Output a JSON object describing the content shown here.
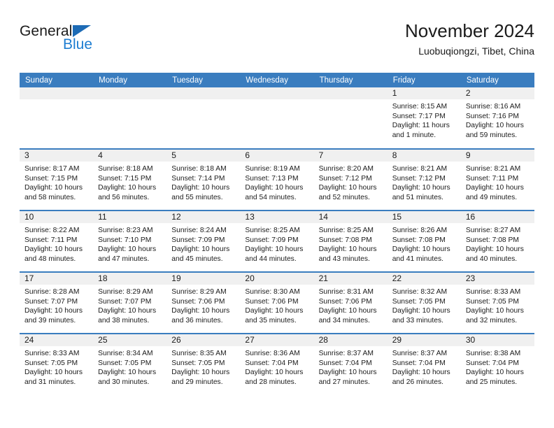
{
  "branding": {
    "logo_text_top": "General",
    "logo_text_bottom": "Blue",
    "logo_triangle_color": "#1d6bb5",
    "logo_blue_color": "#1d7dd1"
  },
  "header": {
    "title": "November 2024",
    "subtitle": "Luobuqiongzi, Tibet, China"
  },
  "colors": {
    "header_band": "#3a7dbf",
    "daynum_band": "#f0f0f0",
    "text": "#1b1b1b"
  },
  "weekdays": [
    "Sunday",
    "Monday",
    "Tuesday",
    "Wednesday",
    "Thursday",
    "Friday",
    "Saturday"
  ],
  "weeks": [
    [
      {
        "day": "",
        "sunrise": "",
        "sunset": "",
        "daylight_line1": "",
        "daylight_line2": ""
      },
      {
        "day": "",
        "sunrise": "",
        "sunset": "",
        "daylight_line1": "",
        "daylight_line2": ""
      },
      {
        "day": "",
        "sunrise": "",
        "sunset": "",
        "daylight_line1": "",
        "daylight_line2": ""
      },
      {
        "day": "",
        "sunrise": "",
        "sunset": "",
        "daylight_line1": "",
        "daylight_line2": ""
      },
      {
        "day": "",
        "sunrise": "",
        "sunset": "",
        "daylight_line1": "",
        "daylight_line2": ""
      },
      {
        "day": "1",
        "sunrise": "Sunrise: 8:15 AM",
        "sunset": "Sunset: 7:17 PM",
        "daylight_line1": "Daylight: 11 hours",
        "daylight_line2": "and 1 minute."
      },
      {
        "day": "2",
        "sunrise": "Sunrise: 8:16 AM",
        "sunset": "Sunset: 7:16 PM",
        "daylight_line1": "Daylight: 10 hours",
        "daylight_line2": "and 59 minutes."
      }
    ],
    [
      {
        "day": "3",
        "sunrise": "Sunrise: 8:17 AM",
        "sunset": "Sunset: 7:15 PM",
        "daylight_line1": "Daylight: 10 hours",
        "daylight_line2": "and 58 minutes."
      },
      {
        "day": "4",
        "sunrise": "Sunrise: 8:18 AM",
        "sunset": "Sunset: 7:15 PM",
        "daylight_line1": "Daylight: 10 hours",
        "daylight_line2": "and 56 minutes."
      },
      {
        "day": "5",
        "sunrise": "Sunrise: 8:18 AM",
        "sunset": "Sunset: 7:14 PM",
        "daylight_line1": "Daylight: 10 hours",
        "daylight_line2": "and 55 minutes."
      },
      {
        "day": "6",
        "sunrise": "Sunrise: 8:19 AM",
        "sunset": "Sunset: 7:13 PM",
        "daylight_line1": "Daylight: 10 hours",
        "daylight_line2": "and 54 minutes."
      },
      {
        "day": "7",
        "sunrise": "Sunrise: 8:20 AM",
        "sunset": "Sunset: 7:12 PM",
        "daylight_line1": "Daylight: 10 hours",
        "daylight_line2": "and 52 minutes."
      },
      {
        "day": "8",
        "sunrise": "Sunrise: 8:21 AM",
        "sunset": "Sunset: 7:12 PM",
        "daylight_line1": "Daylight: 10 hours",
        "daylight_line2": "and 51 minutes."
      },
      {
        "day": "9",
        "sunrise": "Sunrise: 8:21 AM",
        "sunset": "Sunset: 7:11 PM",
        "daylight_line1": "Daylight: 10 hours",
        "daylight_line2": "and 49 minutes."
      }
    ],
    [
      {
        "day": "10",
        "sunrise": "Sunrise: 8:22 AM",
        "sunset": "Sunset: 7:11 PM",
        "daylight_line1": "Daylight: 10 hours",
        "daylight_line2": "and 48 minutes."
      },
      {
        "day": "11",
        "sunrise": "Sunrise: 8:23 AM",
        "sunset": "Sunset: 7:10 PM",
        "daylight_line1": "Daylight: 10 hours",
        "daylight_line2": "and 47 minutes."
      },
      {
        "day": "12",
        "sunrise": "Sunrise: 8:24 AM",
        "sunset": "Sunset: 7:09 PM",
        "daylight_line1": "Daylight: 10 hours",
        "daylight_line2": "and 45 minutes."
      },
      {
        "day": "13",
        "sunrise": "Sunrise: 8:25 AM",
        "sunset": "Sunset: 7:09 PM",
        "daylight_line1": "Daylight: 10 hours",
        "daylight_line2": "and 44 minutes."
      },
      {
        "day": "14",
        "sunrise": "Sunrise: 8:25 AM",
        "sunset": "Sunset: 7:08 PM",
        "daylight_line1": "Daylight: 10 hours",
        "daylight_line2": "and 43 minutes."
      },
      {
        "day": "15",
        "sunrise": "Sunrise: 8:26 AM",
        "sunset": "Sunset: 7:08 PM",
        "daylight_line1": "Daylight: 10 hours",
        "daylight_line2": "and 41 minutes."
      },
      {
        "day": "16",
        "sunrise": "Sunrise: 8:27 AM",
        "sunset": "Sunset: 7:08 PM",
        "daylight_line1": "Daylight: 10 hours",
        "daylight_line2": "and 40 minutes."
      }
    ],
    [
      {
        "day": "17",
        "sunrise": "Sunrise: 8:28 AM",
        "sunset": "Sunset: 7:07 PM",
        "daylight_line1": "Daylight: 10 hours",
        "daylight_line2": "and 39 minutes."
      },
      {
        "day": "18",
        "sunrise": "Sunrise: 8:29 AM",
        "sunset": "Sunset: 7:07 PM",
        "daylight_line1": "Daylight: 10 hours",
        "daylight_line2": "and 38 minutes."
      },
      {
        "day": "19",
        "sunrise": "Sunrise: 8:29 AM",
        "sunset": "Sunset: 7:06 PM",
        "daylight_line1": "Daylight: 10 hours",
        "daylight_line2": "and 36 minutes."
      },
      {
        "day": "20",
        "sunrise": "Sunrise: 8:30 AM",
        "sunset": "Sunset: 7:06 PM",
        "daylight_line1": "Daylight: 10 hours",
        "daylight_line2": "and 35 minutes."
      },
      {
        "day": "21",
        "sunrise": "Sunrise: 8:31 AM",
        "sunset": "Sunset: 7:06 PM",
        "daylight_line1": "Daylight: 10 hours",
        "daylight_line2": "and 34 minutes."
      },
      {
        "day": "22",
        "sunrise": "Sunrise: 8:32 AM",
        "sunset": "Sunset: 7:05 PM",
        "daylight_line1": "Daylight: 10 hours",
        "daylight_line2": "and 33 minutes."
      },
      {
        "day": "23",
        "sunrise": "Sunrise: 8:33 AM",
        "sunset": "Sunset: 7:05 PM",
        "daylight_line1": "Daylight: 10 hours",
        "daylight_line2": "and 32 minutes."
      }
    ],
    [
      {
        "day": "24",
        "sunrise": "Sunrise: 8:33 AM",
        "sunset": "Sunset: 7:05 PM",
        "daylight_line1": "Daylight: 10 hours",
        "daylight_line2": "and 31 minutes."
      },
      {
        "day": "25",
        "sunrise": "Sunrise: 8:34 AM",
        "sunset": "Sunset: 7:05 PM",
        "daylight_line1": "Daylight: 10 hours",
        "daylight_line2": "and 30 minutes."
      },
      {
        "day": "26",
        "sunrise": "Sunrise: 8:35 AM",
        "sunset": "Sunset: 7:05 PM",
        "daylight_line1": "Daylight: 10 hours",
        "daylight_line2": "and 29 minutes."
      },
      {
        "day": "27",
        "sunrise": "Sunrise: 8:36 AM",
        "sunset": "Sunset: 7:04 PM",
        "daylight_line1": "Daylight: 10 hours",
        "daylight_line2": "and 28 minutes."
      },
      {
        "day": "28",
        "sunrise": "Sunrise: 8:37 AM",
        "sunset": "Sunset: 7:04 PM",
        "daylight_line1": "Daylight: 10 hours",
        "daylight_line2": "and 27 minutes."
      },
      {
        "day": "29",
        "sunrise": "Sunrise: 8:37 AM",
        "sunset": "Sunset: 7:04 PM",
        "daylight_line1": "Daylight: 10 hours",
        "daylight_line2": "and 26 minutes."
      },
      {
        "day": "30",
        "sunrise": "Sunrise: 8:38 AM",
        "sunset": "Sunset: 7:04 PM",
        "daylight_line1": "Daylight: 10 hours",
        "daylight_line2": "and 25 minutes."
      }
    ]
  ]
}
